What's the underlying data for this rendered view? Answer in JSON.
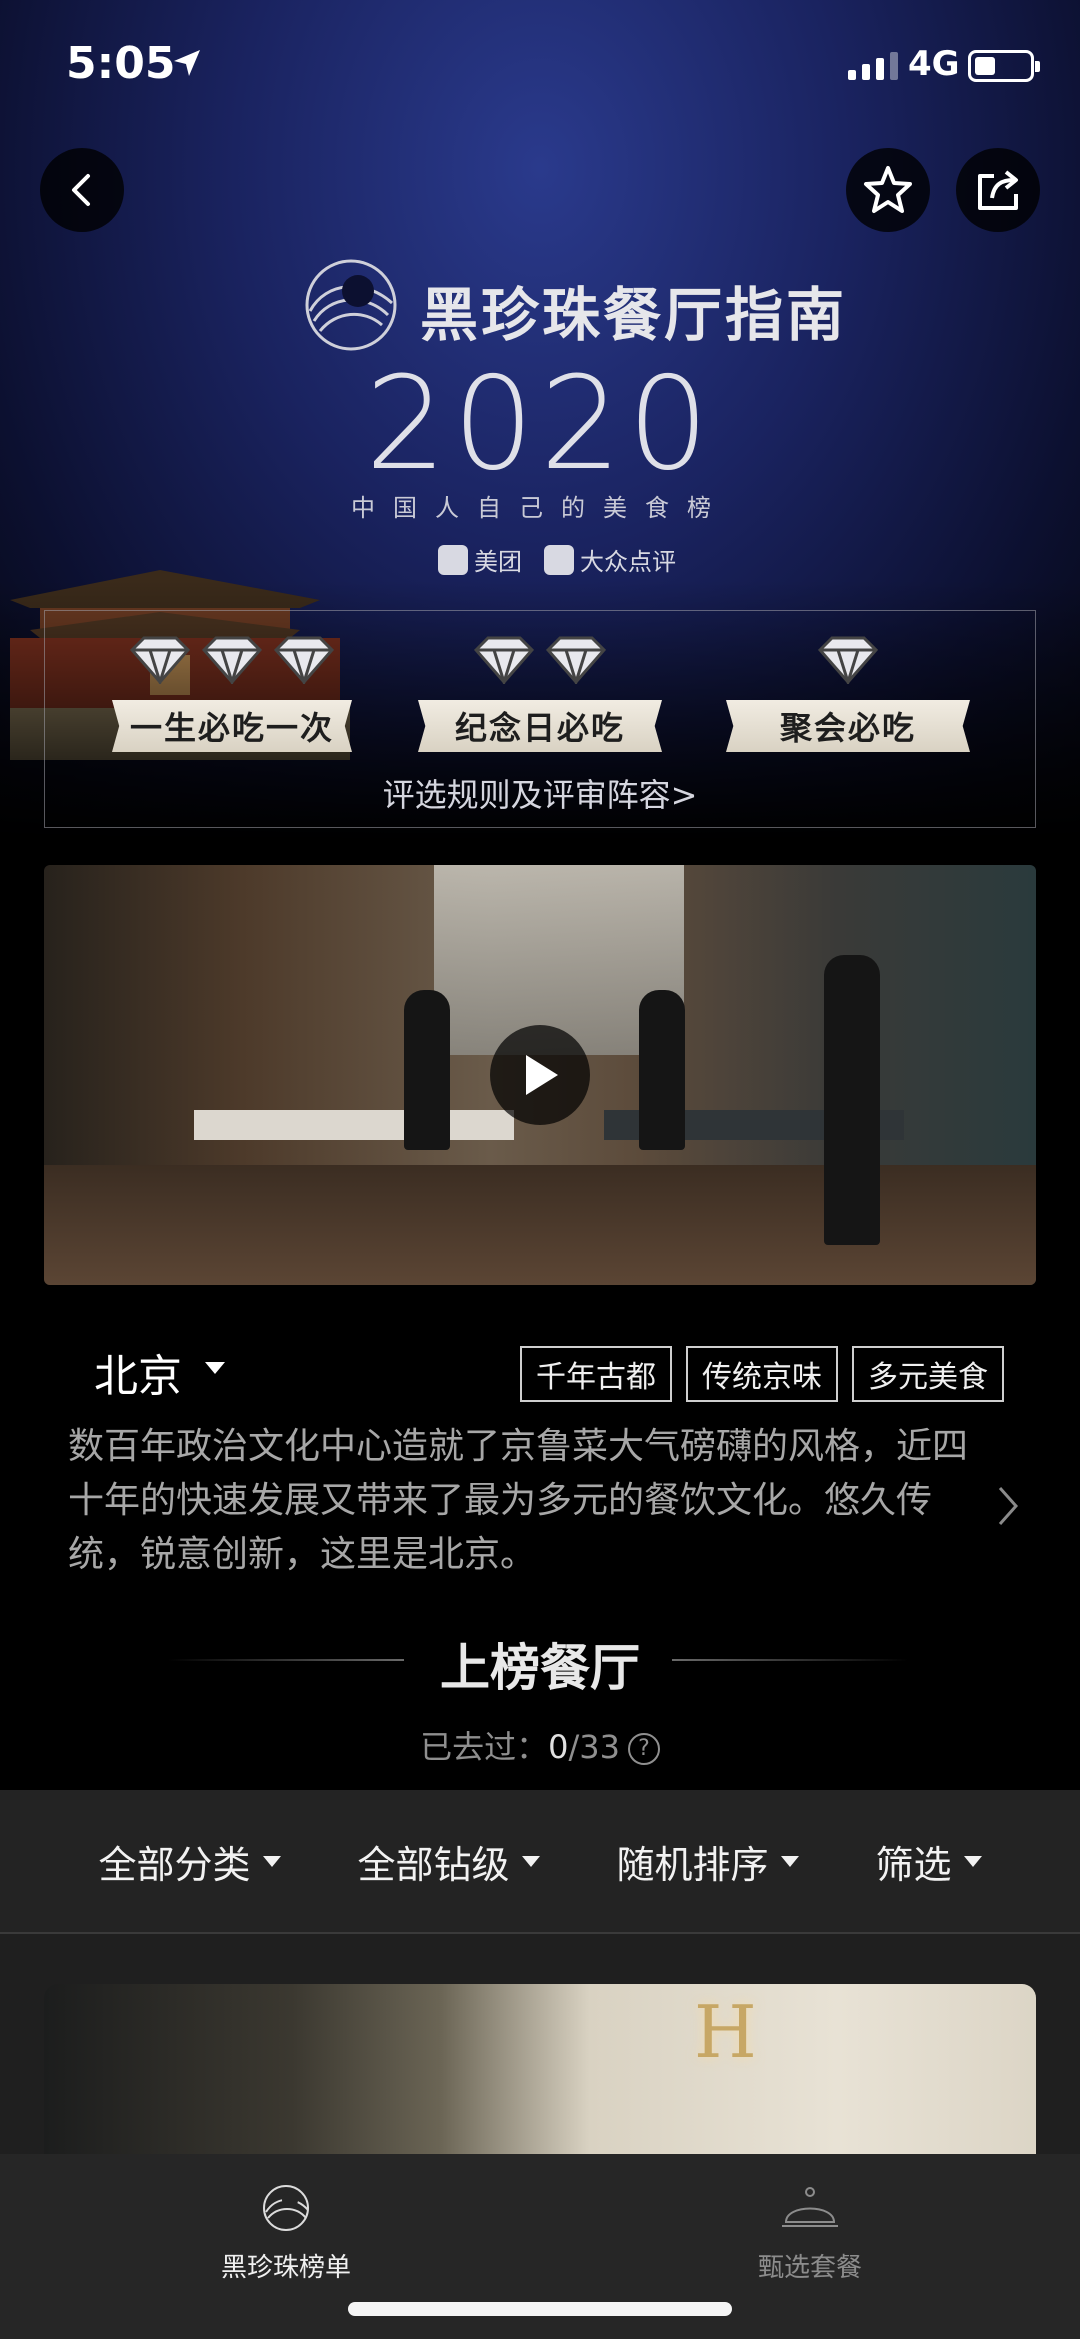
{
  "status_bar": {
    "time": "5:05",
    "network": "4G"
  },
  "header": {
    "back_icon": "chevron-left-icon",
    "favorite_icon": "star-icon",
    "share_icon": "share-icon"
  },
  "hero": {
    "guide_title": "黑珍珠餐厅指南",
    "year": "2020",
    "slogan": "中国人自己的美食榜",
    "partners": [
      "美团",
      "大众点评"
    ],
    "tiers": [
      {
        "label": "一生必吃一次",
        "diamonds": 3
      },
      {
        "label": "纪念日必吃",
        "diamonds": 2
      },
      {
        "label": "聚会必吃",
        "diamonds": 1
      }
    ],
    "rules_link": "评选规则及评审阵容>"
  },
  "video": {
    "play_icon": "play-icon"
  },
  "city": {
    "name": "北京",
    "tags": [
      "千年古都",
      "传统京味",
      "多元美食"
    ],
    "description": "数百年政治文化中心造就了京鲁菜大气磅礴的风格，近四十年的快速发展又带来了最为多元的餐饮文化。悠久传统，锐意创新，这里是北京。"
  },
  "ranking": {
    "title": "上榜餐厅",
    "visited_label": "已去过：",
    "visited_count": "0",
    "visited_total": "/33"
  },
  "filters": [
    "全部分类",
    "全部钻级",
    "随机排序",
    "筛选"
  ],
  "tabbar": {
    "items": [
      {
        "label": "黑珍珠榜单",
        "icon": "pearl-logo-icon",
        "active": true
      },
      {
        "label": "甄选套餐",
        "icon": "cloche-icon",
        "active": false
      }
    ]
  },
  "colors": {
    "hero_blue": "#1a2360",
    "ribbon": "#e6e0d3",
    "tabbar": "#262626",
    "filterbar": "#232323"
  }
}
